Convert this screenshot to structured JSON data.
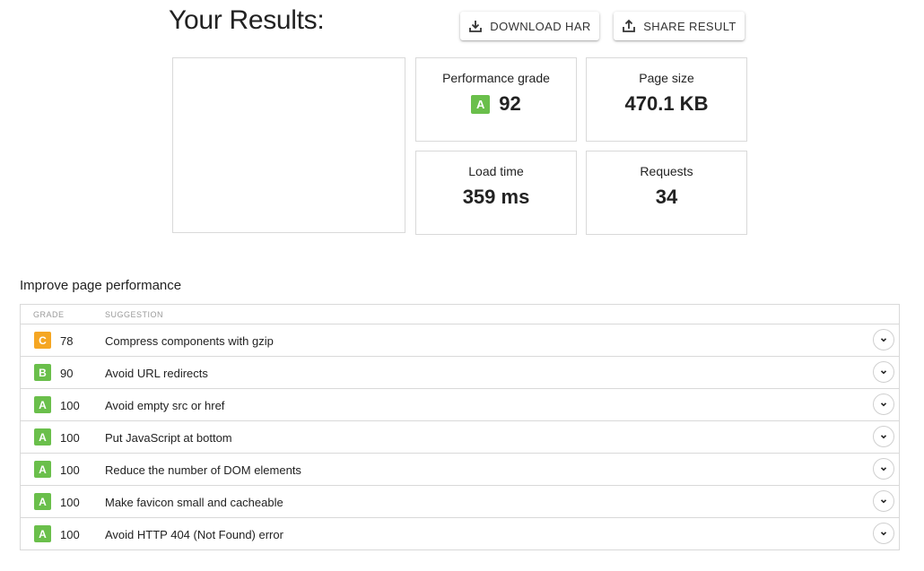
{
  "header": {
    "title": "Your Results:",
    "download_label": "DOWNLOAD HAR",
    "share_label": "SHARE RESULT"
  },
  "colors": {
    "grade_a": "#6abf4b",
    "grade_b": "#6abf4b",
    "grade_c": "#f5a623"
  },
  "metrics": {
    "grade": {
      "label": "Performance grade",
      "letter": "A",
      "value": "92"
    },
    "size": {
      "label": "Page size",
      "value": "470.1 KB"
    },
    "load": {
      "label": "Load time",
      "value": "359 ms"
    },
    "requests": {
      "label": "Requests",
      "value": "34"
    }
  },
  "improve": {
    "title": "Improve page performance",
    "col_grade": "GRADE",
    "col_suggestion": "SUGGESTION",
    "rows": [
      {
        "letter": "C",
        "score": "78",
        "text": "Compress components with gzip"
      },
      {
        "letter": "B",
        "score": "90",
        "text": "Avoid URL redirects"
      },
      {
        "letter": "A",
        "score": "100",
        "text": "Avoid empty src or href"
      },
      {
        "letter": "A",
        "score": "100",
        "text": "Put JavaScript at bottom"
      },
      {
        "letter": "A",
        "score": "100",
        "text": "Reduce the number of DOM elements"
      },
      {
        "letter": "A",
        "score": "100",
        "text": "Make favicon small and cacheable"
      },
      {
        "letter": "A",
        "score": "100",
        "text": "Avoid HTTP 404 (Not Found) error"
      }
    ]
  }
}
